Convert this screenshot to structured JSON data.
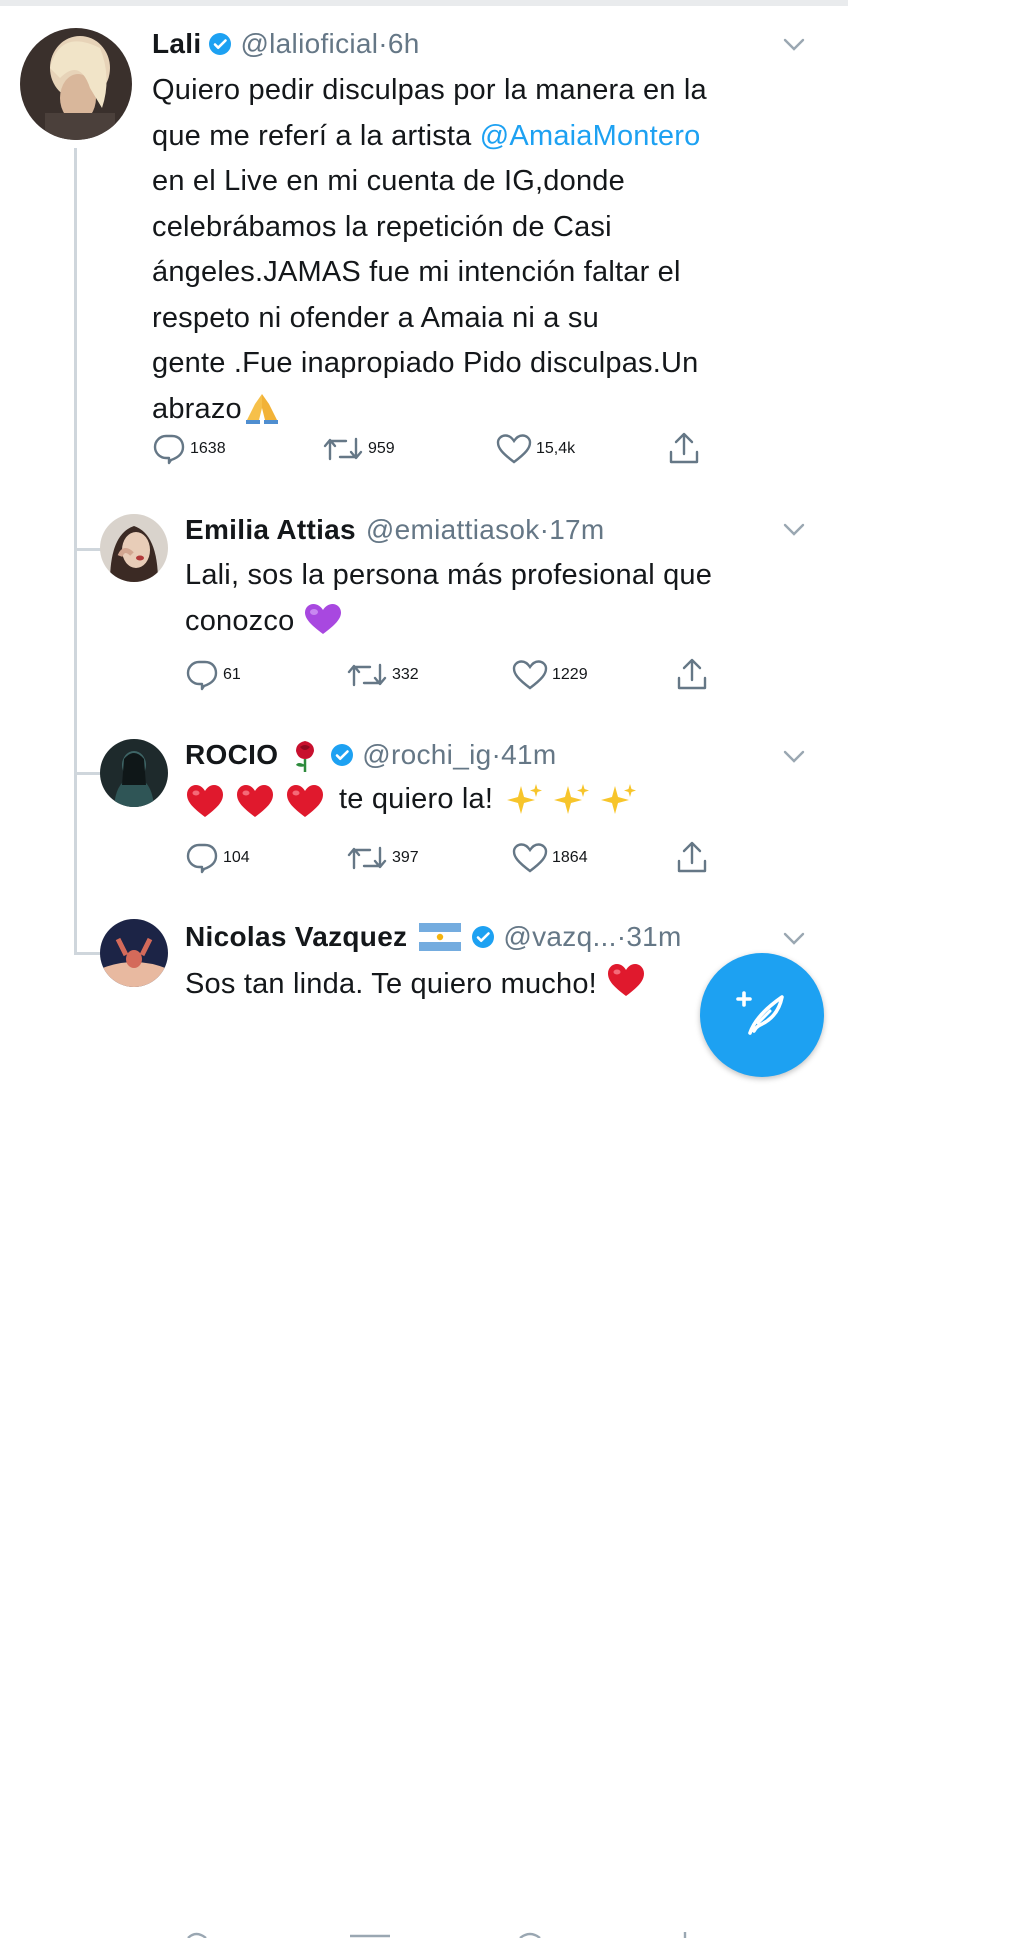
{
  "accent": "#1da1f2",
  "tweets": [
    {
      "name": "Lali",
      "verified": true,
      "handle": "@lalioficial",
      "dot": "·",
      "time": "6h",
      "text": {
        "l1": "Quiero pedir disculpas por la manera en la",
        "l2a": "que me referí a la artista ",
        "l2b": "@AmaiaMontero",
        "l3": "en el Live en mi cuenta de IG,donde",
        "l4": "celebrábamos la repetición de Casi",
        "l5": "ángeles.JAMAS fue mi intención faltar el",
        "l6": "respeto ni ofender a Amaia ni a su",
        "l7": "gente .Fue inapropiado Pido disculpas.Un",
        "l8": "abrazo"
      },
      "emoji": "folded-hands",
      "replies": "1638",
      "retweets": "959",
      "likes": "15,4k"
    },
    {
      "name": "Emilia Attias",
      "verified": false,
      "handle": "@emiattiasok",
      "dot": "·",
      "time": "17m",
      "text": {
        "l1": "Lali, sos la persona más profesional que",
        "l2": "conozco"
      },
      "emoji": "purple-heart",
      "replies": "61",
      "retweets": "332",
      "likes": "1229"
    },
    {
      "name": "ROCIO",
      "verified": true,
      "handle": "@rochi_ig",
      "dot": "·",
      "time": "41m",
      "text": {
        "l1": "te quiero la!"
      },
      "emoji": "red-hearts-and-sparkles",
      "replies": "104",
      "retweets": "397",
      "likes": "1864"
    },
    {
      "name": "Nicolas Vazquez",
      "verified": true,
      "handle": "@vazq...",
      "dot": "·",
      "time": "31m",
      "text": {
        "l1": "Sos tan linda. Te quiero mucho!"
      },
      "emoji": "red-heart"
    }
  ],
  "icons": [
    "reply-icon",
    "retweet-icon",
    "like-icon",
    "share-icon",
    "chevron-down-icon",
    "verified-badge-icon",
    "compose-tweet-icon"
  ]
}
